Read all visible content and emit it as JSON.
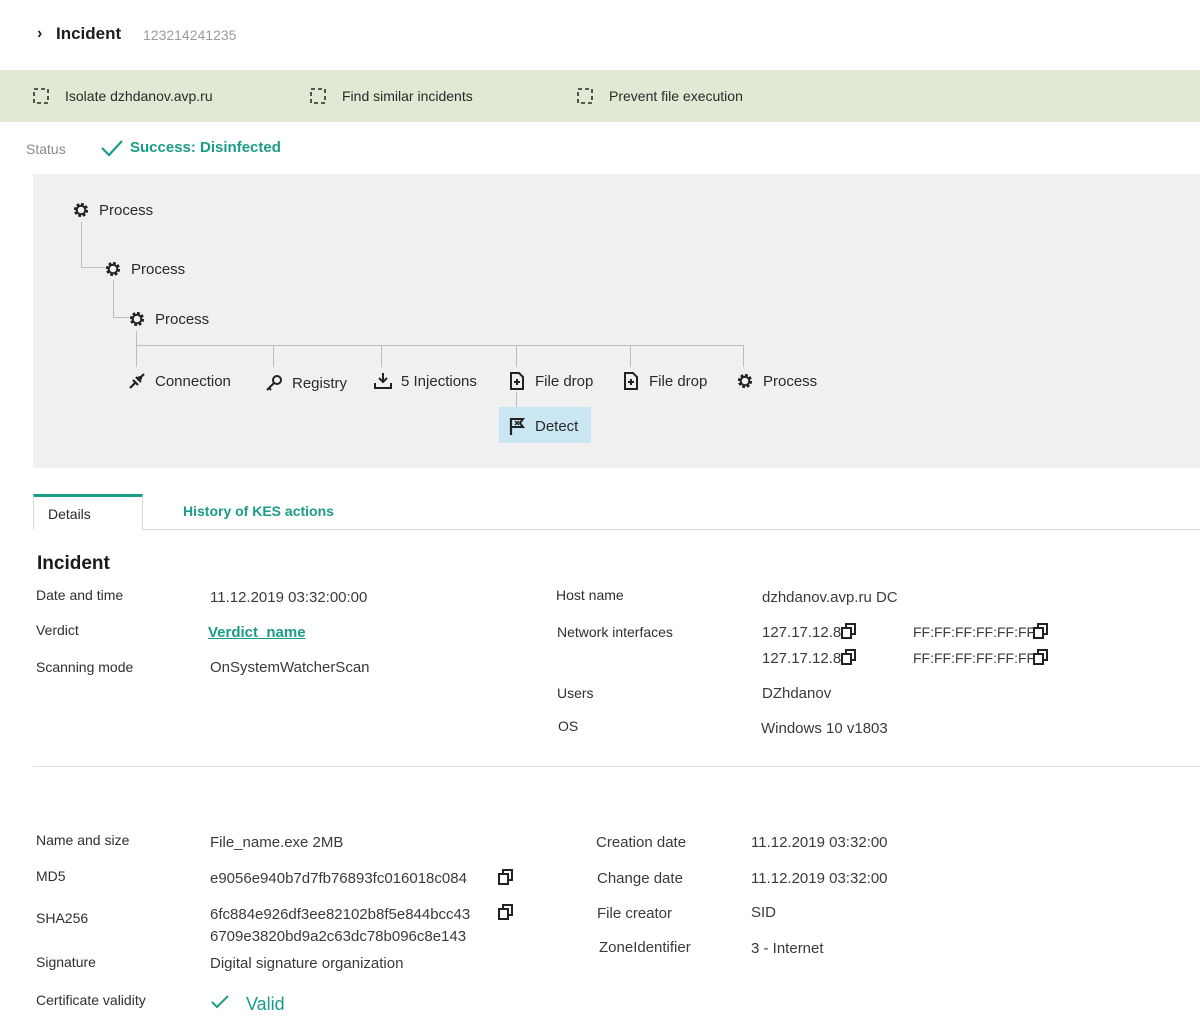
{
  "header": {
    "chevron": "›",
    "title": "Incident",
    "incident_id": "123214241235"
  },
  "toolbar": {
    "actions": [
      {
        "label": "Isolate dzhdanov.avp.ru"
      },
      {
        "label": "Find similar incidents"
      },
      {
        "label": "Prevent file execution"
      }
    ]
  },
  "status": {
    "label": "Status",
    "value": "Success: Disinfected",
    "color": "#1a9c86"
  },
  "graph": {
    "nodes": {
      "process1": "Process",
      "process2": "Process",
      "process3": "Process",
      "connection": "Connection",
      "registry": "Registry",
      "injections": "5 Injections",
      "file_drop1": "File drop",
      "file_drop2": "File drop",
      "process4": "Process",
      "detect": "Detect"
    },
    "highlight_color": "#c9e6f2"
  },
  "tabs": [
    {
      "label": "Details",
      "active": true
    },
    {
      "label": "History of KES actions",
      "active": false
    }
  ],
  "incident": {
    "title": "Incident",
    "date_label": "Date and time",
    "date_value": "11.12.2019 03:32:00:00",
    "verdict_label": "Verdict",
    "verdict_value": "Verdict_name",
    "scan_label": "Scanning mode",
    "scan_value": "OnSystemWatcherScan",
    "host_label": "Host name",
    "host_value": "dzhdanov.avp.ru  DC",
    "net_label": "Network interfaces",
    "net_rows": [
      {
        "ip": "127.17.12.8",
        "mac": "FF:FF:FF:FF:FF:FF"
      },
      {
        "ip": "127.17.12.8",
        "mac": "FF:FF:FF:FF:FF:FF"
      }
    ],
    "users_label": "Users",
    "users_value": "DZhdanov",
    "os_label": "OS",
    "os_value": "Windows 10 v1803"
  },
  "file": {
    "name_label": "Name and size",
    "name_value": "File_name.exe   2MB",
    "md5_label": "MD5",
    "md5_value": "e9056e940b7d7fb76893fc016018c084",
    "sha_label": "SHA256",
    "sha_line1": "6fc884e926df3ee82102b8f5e844bcc43",
    "sha_line2": "6709e3820bd9a2c63dc78b096c8e143",
    "sig_label": "Signature",
    "sig_value": "Digital signature organization",
    "cert_label": "Certificate validity",
    "cert_value": "Valid",
    "created_label": "Creation date",
    "created_value": "11.12.2019 03:32:00",
    "changed_label": "Change date",
    "changed_value": "11.12.2019 03:32:00",
    "creator_label": "File creator",
    "creator_value": "SID",
    "zone_label": "ZoneIdentifier",
    "zone_value": "3 - Internet"
  }
}
